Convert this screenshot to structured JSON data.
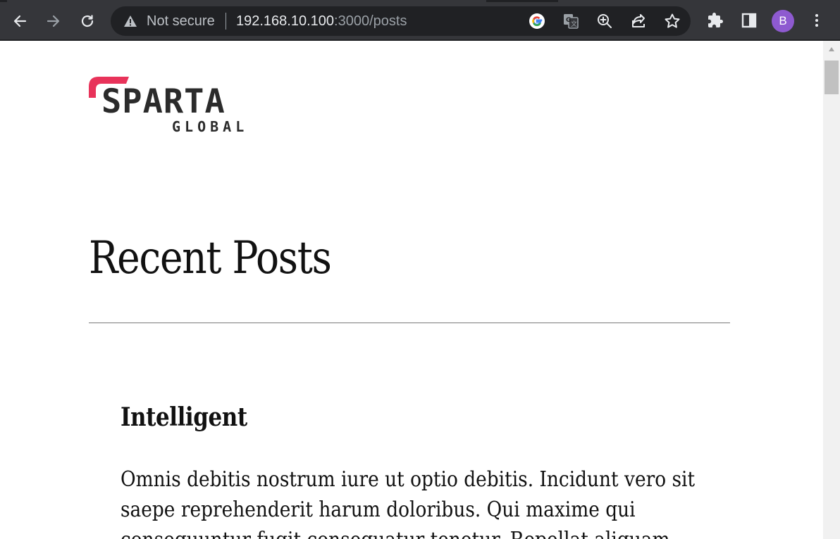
{
  "browser": {
    "security_label": "Not secure",
    "url_host": "192.168.10.100",
    "url_rest": ":3000/posts",
    "avatar_initial": "B",
    "accent_colors": {
      "chrome": "#35363a",
      "omnibox": "#202124",
      "avatar": "#8e5ad0"
    }
  },
  "page": {
    "logo": {
      "word": "SPARTA",
      "sub": "GLOBAL",
      "accent_color": "#e8335a"
    },
    "title": "Recent Posts",
    "posts": [
      {
        "title": "Intelligent",
        "body": "Omnis debitis nostrum iure ut optio debitis. Incidunt vero sit saepe reprehenderit harum doloribus. Qui maxime qui consequuntur fugit consequatur tenetur. Repellat aliquam"
      }
    ]
  }
}
